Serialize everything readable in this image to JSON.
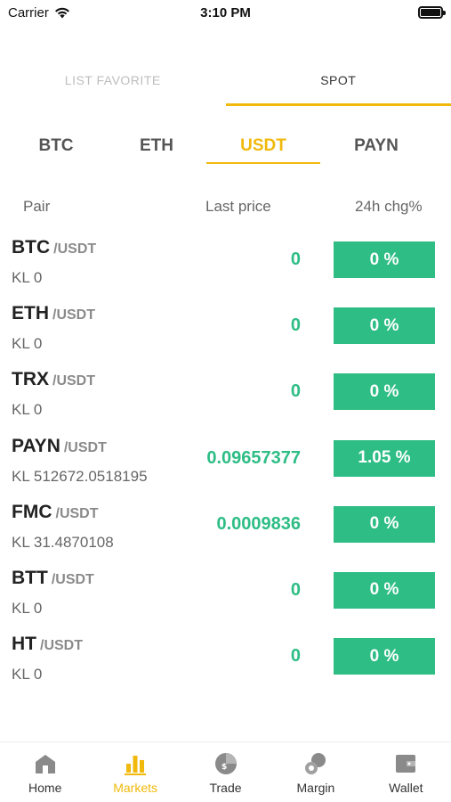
{
  "status_bar": {
    "carrier": "Carrier",
    "time": "3:10 PM"
  },
  "top_tabs": [
    {
      "label": "LIST FAVORITE",
      "active": false
    },
    {
      "label": "SPOT",
      "active": true
    }
  ],
  "coin_tabs": [
    {
      "label": "BTC",
      "active": false
    },
    {
      "label": "ETH",
      "active": false
    },
    {
      "label": "USDT",
      "active": true
    },
    {
      "label": "PAYN",
      "active": false
    }
  ],
  "columns": {
    "pair": "Pair",
    "last_price": "Last price",
    "change": "24h chg%"
  },
  "rows": [
    {
      "base": "BTC",
      "quote": "/USDT",
      "volume": "KL 0",
      "price": "0",
      "change": "0 %"
    },
    {
      "base": "ETH",
      "quote": "/USDT",
      "volume": "KL 0",
      "price": "0",
      "change": "0 %"
    },
    {
      "base": "TRX",
      "quote": "/USDT",
      "volume": "KL 0",
      "price": "0",
      "change": "0 %"
    },
    {
      "base": "PAYN",
      "quote": "/USDT",
      "volume": "KL 512672.0518195",
      "price": "0.09657377",
      "change": "1.05 %"
    },
    {
      "base": "FMC",
      "quote": "/USDT",
      "volume": "KL 31.4870108",
      "price": "0.0009836",
      "change": "0 %"
    },
    {
      "base": "BTT",
      "quote": "/USDT",
      "volume": "KL 0",
      "price": "0",
      "change": "0 %"
    },
    {
      "base": "HT",
      "quote": "/USDT",
      "volume": "KL 0",
      "price": "0",
      "change": "0 %"
    }
  ],
  "bottom_nav": [
    {
      "label": "Home",
      "icon": "home-icon",
      "active": false
    },
    {
      "label": "Markets",
      "icon": "markets-icon",
      "active": true
    },
    {
      "label": "Trade",
      "icon": "trade-icon",
      "active": false
    },
    {
      "label": "Margin",
      "icon": "margin-icon",
      "active": false
    },
    {
      "label": "Wallet",
      "icon": "wallet-icon",
      "active": false
    }
  ],
  "colors": {
    "accent": "#f0b90b",
    "positive": "#2ebd85",
    "icon_gray": "#8a8a8a"
  }
}
